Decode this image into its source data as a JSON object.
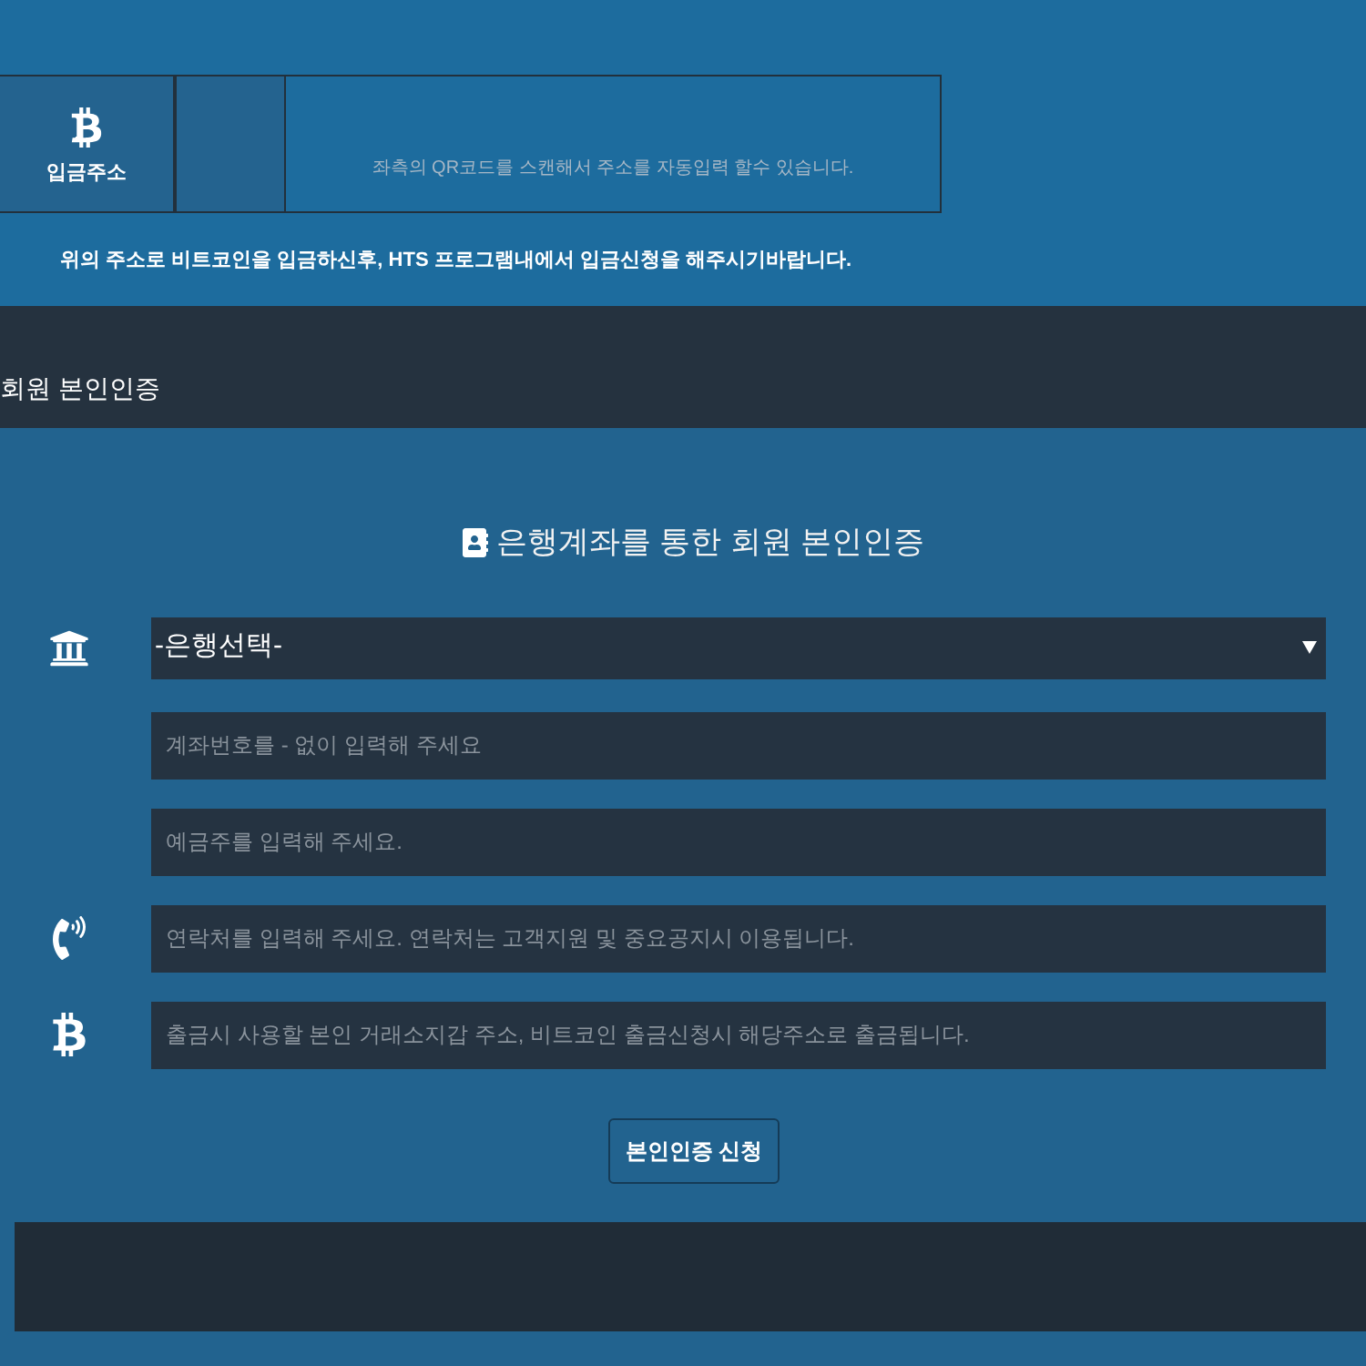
{
  "deposit": {
    "label": "입금주소",
    "qr_hint": "좌측의 QR코드를 스캔해서 주소를 자동입력 할수 있습니다.",
    "notice": "위의 주소로 비트코인을 입금하신후, HTS 프로그램내에서 입금신청을 해주시기바랍니다."
  },
  "section": {
    "title": "회원 본인인증"
  },
  "form": {
    "heading": "은행계좌를 통한 회원 본인인증",
    "fields": [
      {
        "kind": "bank-select",
        "value": "-은행선택-"
      },
      {
        "kind": "plain",
        "placeholder": "계좌번호를 - 없이 입력해 주세요"
      },
      {
        "kind": "plain",
        "placeholder": "예금주를 입력해 주세요."
      },
      {
        "kind": "phone",
        "placeholder": "연락처를 입력해 주세요. 연락처는 고객지원 및 중요공지시 이용됩니다."
      },
      {
        "kind": "wallet",
        "placeholder": "출금시 사용할 본인 거래소지갑 주소, 비트코인 출금신청시 해당주소로 출금됩니다."
      }
    ],
    "submit": "본인인증 신청"
  }
}
